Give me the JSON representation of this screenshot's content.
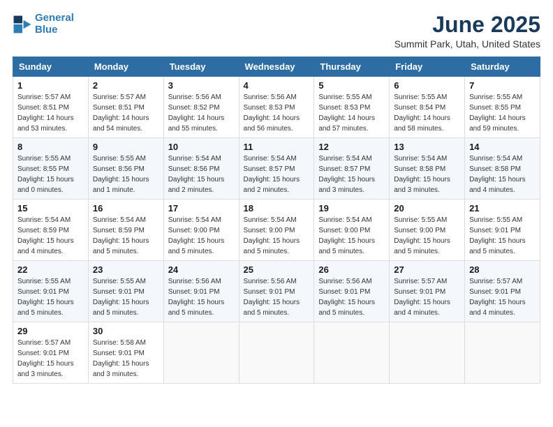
{
  "logo": {
    "line1": "General",
    "line2": "Blue"
  },
  "title": "June 2025",
  "subtitle": "Summit Park, Utah, United States",
  "headers": [
    "Sunday",
    "Monday",
    "Tuesday",
    "Wednesday",
    "Thursday",
    "Friday",
    "Saturday"
  ],
  "weeks": [
    [
      {
        "day": "1",
        "sunrise": "5:57 AM",
        "sunset": "8:51 PM",
        "daylight": "14 hours and 53 minutes."
      },
      {
        "day": "2",
        "sunrise": "5:57 AM",
        "sunset": "8:51 PM",
        "daylight": "14 hours and 54 minutes."
      },
      {
        "day": "3",
        "sunrise": "5:56 AM",
        "sunset": "8:52 PM",
        "daylight": "14 hours and 55 minutes."
      },
      {
        "day": "4",
        "sunrise": "5:56 AM",
        "sunset": "8:53 PM",
        "daylight": "14 hours and 56 minutes."
      },
      {
        "day": "5",
        "sunrise": "5:55 AM",
        "sunset": "8:53 PM",
        "daylight": "14 hours and 57 minutes."
      },
      {
        "day": "6",
        "sunrise": "5:55 AM",
        "sunset": "8:54 PM",
        "daylight": "14 hours and 58 minutes."
      },
      {
        "day": "7",
        "sunrise": "5:55 AM",
        "sunset": "8:55 PM",
        "daylight": "14 hours and 59 minutes."
      }
    ],
    [
      {
        "day": "8",
        "sunrise": "5:55 AM",
        "sunset": "8:55 PM",
        "daylight": "15 hours and 0 minutes."
      },
      {
        "day": "9",
        "sunrise": "5:55 AM",
        "sunset": "8:56 PM",
        "daylight": "15 hours and 1 minute."
      },
      {
        "day": "10",
        "sunrise": "5:54 AM",
        "sunset": "8:56 PM",
        "daylight": "15 hours and 2 minutes."
      },
      {
        "day": "11",
        "sunrise": "5:54 AM",
        "sunset": "8:57 PM",
        "daylight": "15 hours and 2 minutes."
      },
      {
        "day": "12",
        "sunrise": "5:54 AM",
        "sunset": "8:57 PM",
        "daylight": "15 hours and 3 minutes."
      },
      {
        "day": "13",
        "sunrise": "5:54 AM",
        "sunset": "8:58 PM",
        "daylight": "15 hours and 3 minutes."
      },
      {
        "day": "14",
        "sunrise": "5:54 AM",
        "sunset": "8:58 PM",
        "daylight": "15 hours and 4 minutes."
      }
    ],
    [
      {
        "day": "15",
        "sunrise": "5:54 AM",
        "sunset": "8:59 PM",
        "daylight": "15 hours and 4 minutes."
      },
      {
        "day": "16",
        "sunrise": "5:54 AM",
        "sunset": "8:59 PM",
        "daylight": "15 hours and 5 minutes."
      },
      {
        "day": "17",
        "sunrise": "5:54 AM",
        "sunset": "9:00 PM",
        "daylight": "15 hours and 5 minutes."
      },
      {
        "day": "18",
        "sunrise": "5:54 AM",
        "sunset": "9:00 PM",
        "daylight": "15 hours and 5 minutes."
      },
      {
        "day": "19",
        "sunrise": "5:54 AM",
        "sunset": "9:00 PM",
        "daylight": "15 hours and 5 minutes."
      },
      {
        "day": "20",
        "sunrise": "5:55 AM",
        "sunset": "9:00 PM",
        "daylight": "15 hours and 5 minutes."
      },
      {
        "day": "21",
        "sunrise": "5:55 AM",
        "sunset": "9:01 PM",
        "daylight": "15 hours and 5 minutes."
      }
    ],
    [
      {
        "day": "22",
        "sunrise": "5:55 AM",
        "sunset": "9:01 PM",
        "daylight": "15 hours and 5 minutes."
      },
      {
        "day": "23",
        "sunrise": "5:55 AM",
        "sunset": "9:01 PM",
        "daylight": "15 hours and 5 minutes."
      },
      {
        "day": "24",
        "sunrise": "5:56 AM",
        "sunset": "9:01 PM",
        "daylight": "15 hours and 5 minutes."
      },
      {
        "day": "25",
        "sunrise": "5:56 AM",
        "sunset": "9:01 PM",
        "daylight": "15 hours and 5 minutes."
      },
      {
        "day": "26",
        "sunrise": "5:56 AM",
        "sunset": "9:01 PM",
        "daylight": "15 hours and 5 minutes."
      },
      {
        "day": "27",
        "sunrise": "5:57 AM",
        "sunset": "9:01 PM",
        "daylight": "15 hours and 4 minutes."
      },
      {
        "day": "28",
        "sunrise": "5:57 AM",
        "sunset": "9:01 PM",
        "daylight": "15 hours and 4 minutes."
      }
    ],
    [
      {
        "day": "29",
        "sunrise": "5:57 AM",
        "sunset": "9:01 PM",
        "daylight": "15 hours and 3 minutes."
      },
      {
        "day": "30",
        "sunrise": "5:58 AM",
        "sunset": "9:01 PM",
        "daylight": "15 hours and 3 minutes."
      },
      null,
      null,
      null,
      null,
      null
    ]
  ]
}
